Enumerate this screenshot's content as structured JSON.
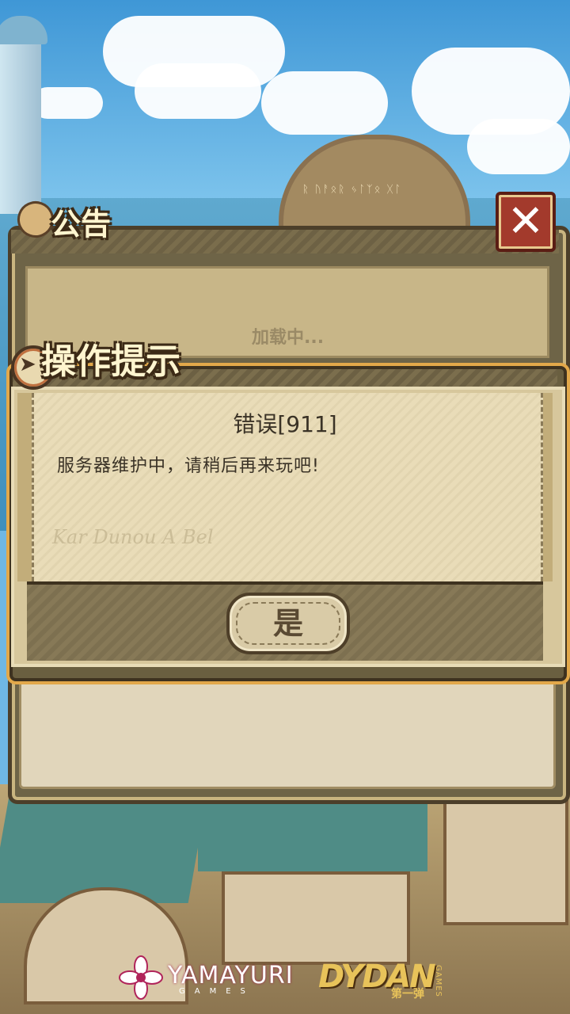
{
  "announcement": {
    "title": "公告",
    "loading_text": "加载中...",
    "close_icon": "close-x-icon"
  },
  "dialog": {
    "title": "操作提示",
    "error_title": "错误[911]",
    "message": "服务器维护中，请稍后再来玩吧!",
    "confirm_label": "是",
    "map_decoration_text": "Kar Dunou A Bel"
  },
  "logos": {
    "publisher": "YAMAYURI",
    "publisher_sub": "GAMES",
    "developer": "DYDAN",
    "developer_sub": "第一弹",
    "developer_games": "GAMES"
  },
  "colors": {
    "panel_brown": "#6e6447",
    "parchment": "#e9dcb8",
    "close_red": "#a33a2c",
    "dialog_border_orange": "#e2a84a"
  }
}
